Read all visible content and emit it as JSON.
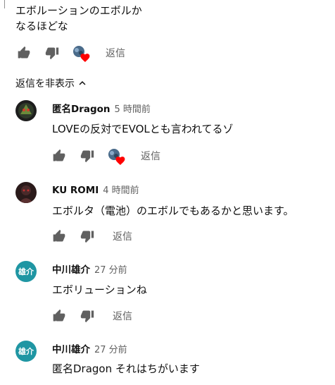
{
  "top_comment": {
    "text_line1": "エボルーションのエボルか",
    "text_line2": "なるほどな",
    "reply_label": "返信"
  },
  "replies_toggle": {
    "label": "返信を非表示"
  },
  "replies": [
    {
      "author": "匿名Dragon",
      "time": "5 時間前",
      "text": "LOVEの反対でEVOLとも言われてるゾ",
      "reply_label": "返信",
      "avatar": "dragon",
      "hearted": true
    },
    {
      "author": "KU ROMI",
      "time": "4 時間前",
      "text": "エボルタ（電池）のエボルでもあるかと思います。",
      "reply_label": "返信",
      "avatar": "dark",
      "hearted": false
    },
    {
      "author": "中川雄介",
      "time": "27 分前",
      "text": "エボリューションね",
      "reply_label": "返信",
      "avatar": "letter",
      "avatar_text": "雄介",
      "hearted": false
    },
    {
      "author": "中川雄介",
      "time": "27 分前",
      "text": "匿名Dragon それはちがいます",
      "avatar": "letter",
      "avatar_text": "雄介",
      "hearted": false
    }
  ],
  "colors": {
    "text": "#0f0f0f",
    "meta": "#606060",
    "heart": "#ff0000",
    "avatar_teal": "#1f96a3"
  },
  "icons": [
    "thumb-up-icon",
    "thumb-down-icon",
    "creator-heart-icon",
    "chevron-up-icon"
  ]
}
